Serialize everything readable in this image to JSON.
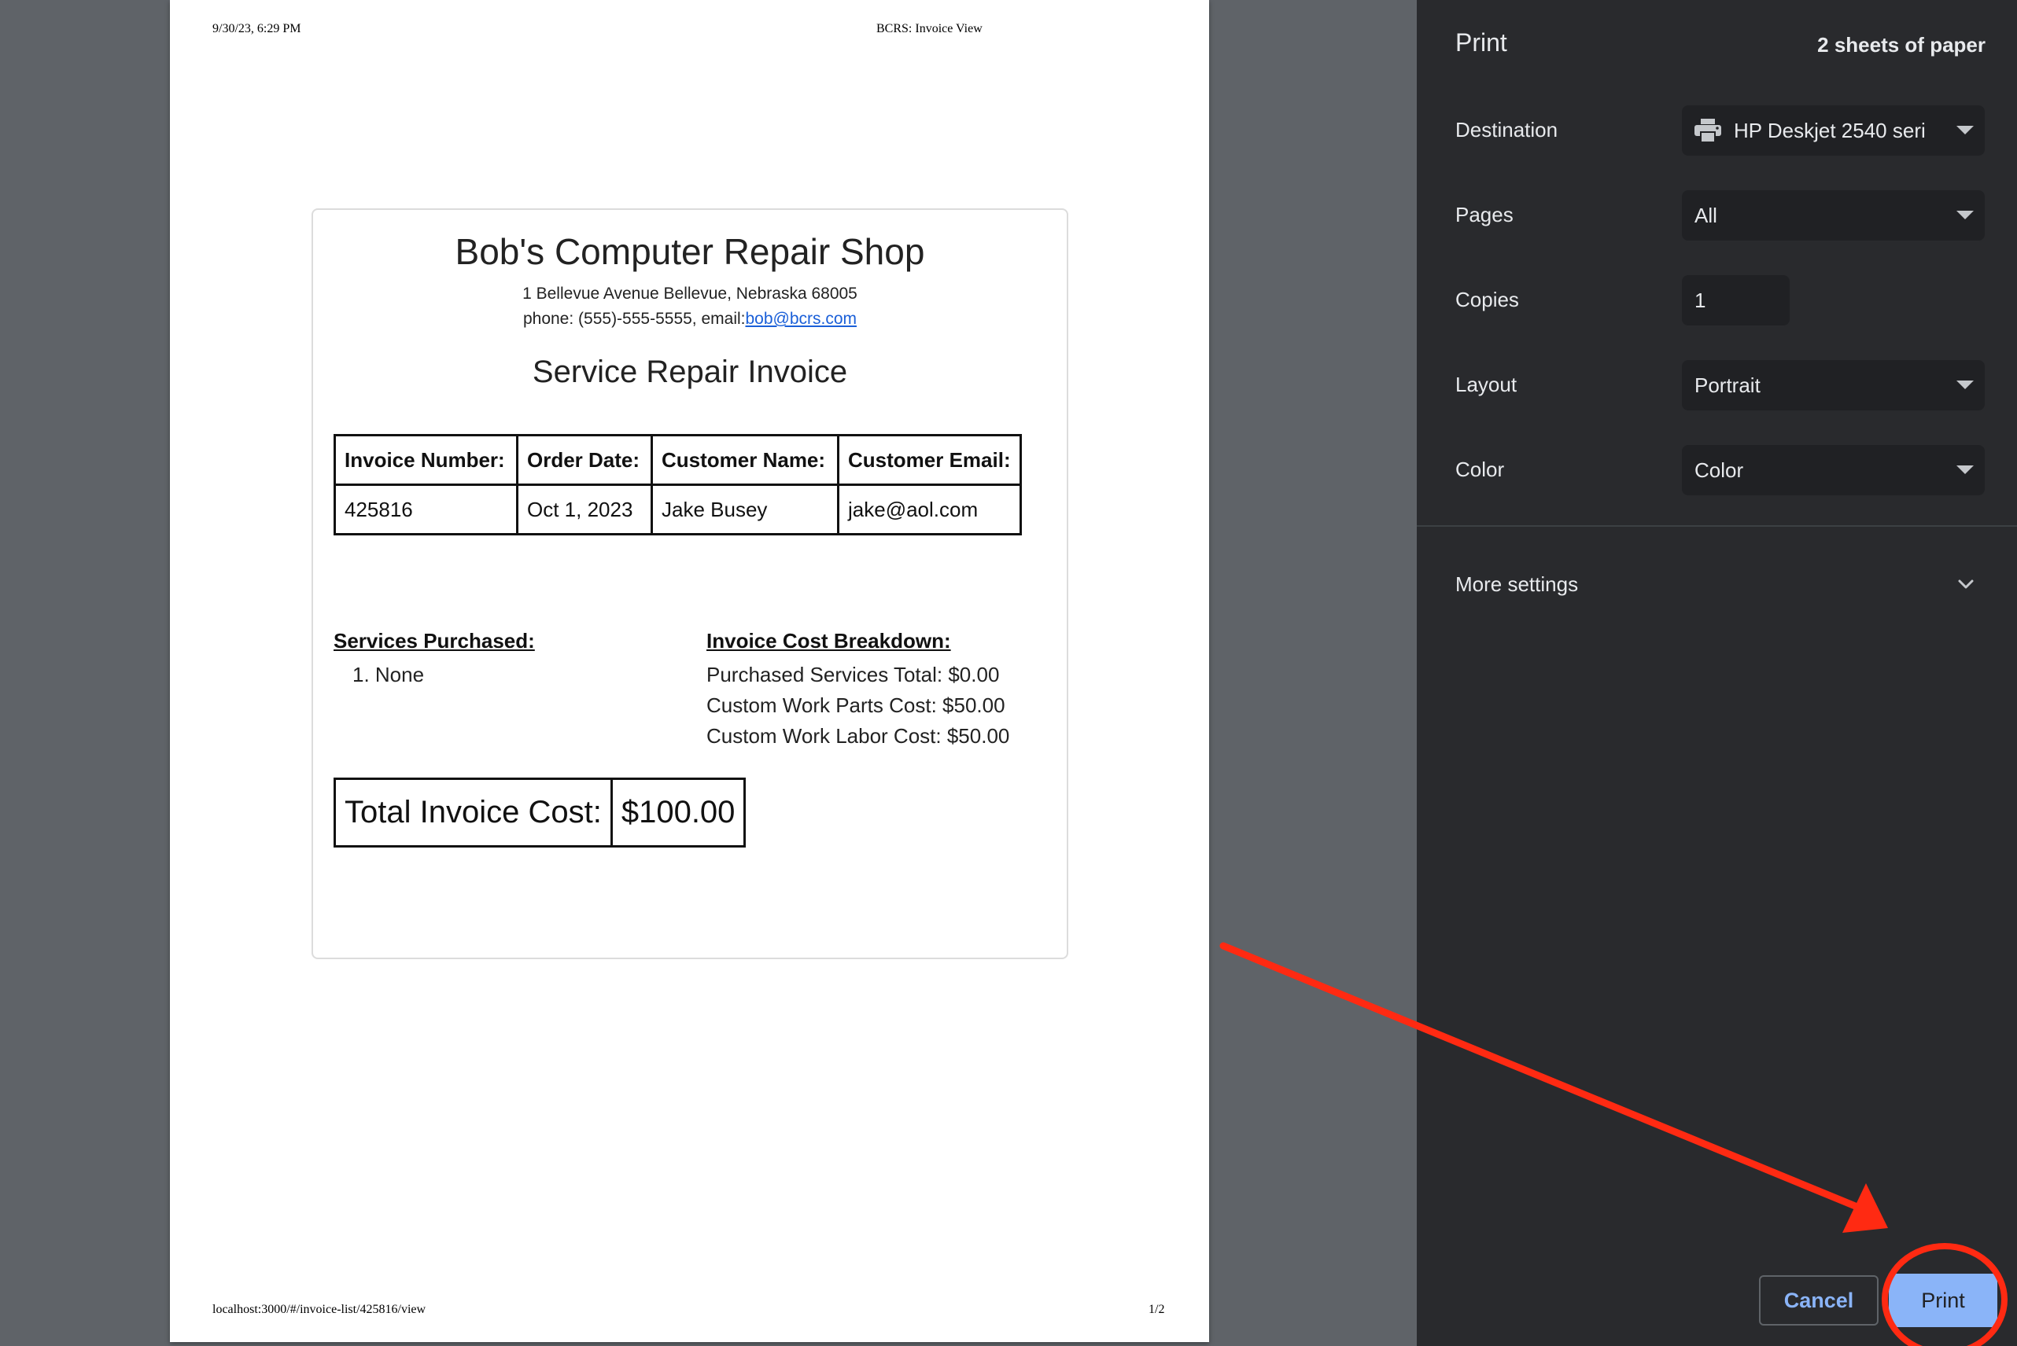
{
  "page_header": {
    "datetime": "9/30/23, 6:29 PM",
    "title": "BCRS: Invoice View"
  },
  "page_footer": {
    "url": "localhost:3000/#/invoice-list/425816/view",
    "page_number": "1/2"
  },
  "invoice": {
    "shop_name": "Bob's Computer Repair Shop",
    "address": "1 Bellevue Avenue Bellevue, Nebraska 68005",
    "phone_prefix": "phone: (555)-555-5555, email:",
    "email": "bob@bcrs.com",
    "title": "Service Repair Invoice",
    "table_headers": [
      "Invoice Number:",
      "Order Date:",
      "Customer Name:",
      "Customer Email:"
    ],
    "table_values": [
      "425816",
      "Oct 1, 2023",
      "Jake Busey",
      "jake@aol.com"
    ],
    "services_heading": "Services Purchased:",
    "services": [
      "1. None"
    ],
    "breakdown_heading": "Invoice Cost Breakdown:",
    "breakdown": [
      "Purchased Services Total: $0.00",
      "Custom Work Parts Cost: $50.00",
      "Custom Work Labor Cost: $50.00"
    ],
    "total_label": "Total Invoice Cost:",
    "total_value": "$100.00"
  },
  "print_panel": {
    "title": "Print",
    "sheets": "2 sheets of paper",
    "destination_label": "Destination",
    "destination_value": "HP Deskjet 2540 seri",
    "pages_label": "Pages",
    "pages_value": "All",
    "copies_label": "Copies",
    "copies_value": "1",
    "layout_label": "Layout",
    "layout_value": "Portrait",
    "color_label": "Color",
    "color_value": "Color",
    "more_settings": "More settings",
    "cancel_label": "Cancel",
    "print_label": "Print"
  },
  "colors": {
    "panel_bg": "#292a2d",
    "field_bg": "#202124",
    "accent": "#8ab4f8",
    "annotation": "#ff2a12"
  }
}
